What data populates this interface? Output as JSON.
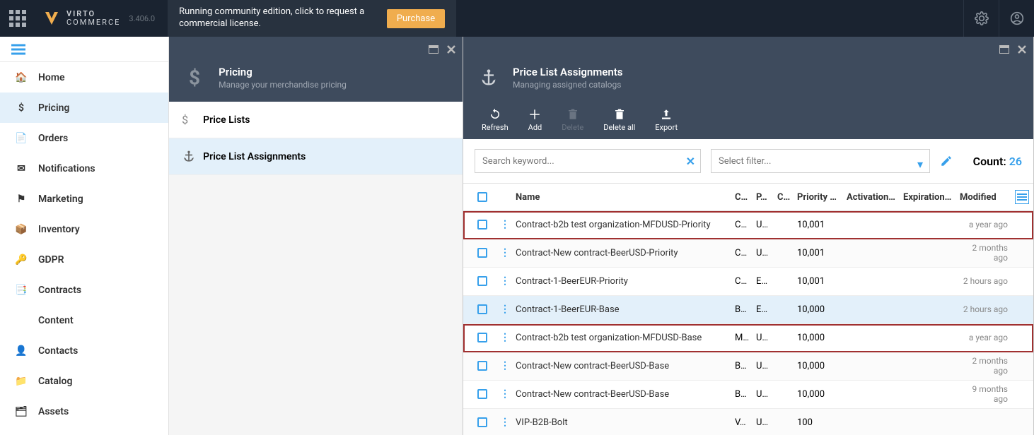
{
  "topbar": {
    "brand_top": "VIRTO",
    "brand_bottom": "COMMERCE",
    "version": "3.406.0",
    "banner": "Running community edition, click to request a commercial license.",
    "purchase": "Purchase"
  },
  "nav": {
    "items": [
      {
        "label": "Home"
      },
      {
        "label": "Pricing"
      },
      {
        "label": "Orders"
      },
      {
        "label": "Notifications"
      },
      {
        "label": "Marketing"
      },
      {
        "label": "Inventory"
      },
      {
        "label": "GDPR"
      },
      {
        "label": "Contracts"
      },
      {
        "label": "Content"
      },
      {
        "label": "Contacts"
      },
      {
        "label": "Catalog"
      },
      {
        "label": "Assets"
      }
    ],
    "active_index": 1
  },
  "blade1": {
    "title": "Pricing",
    "subtitle": "Manage your merchandise pricing",
    "items": [
      {
        "label": "Price Lists"
      },
      {
        "label": "Price List Assignments"
      }
    ],
    "selected_index": 1
  },
  "blade2": {
    "title": "Price List Assignments",
    "subtitle": "Managing assigned catalogs",
    "toolbar": [
      {
        "label": "Refresh",
        "disabled": false
      },
      {
        "label": "Add",
        "disabled": false
      },
      {
        "label": "Delete",
        "disabled": true
      },
      {
        "label": "Delete all",
        "disabled": false
      },
      {
        "label": "Export",
        "disabled": false
      }
    ],
    "search_placeholder": "Search keyword...",
    "filter_placeholder": "Select filter...",
    "count_label": "Count:",
    "count_value": "26",
    "columns": {
      "name": "Name",
      "c3": "C…",
      "c4": "P…",
      "c5": "C…",
      "priority": "Priority …",
      "activation": "Activation…",
      "expiration": "Expiration…",
      "modified": "Modified"
    },
    "rows": [
      {
        "name": "Contract-b2b test organization-MFDUSD-Priority",
        "c3": "C…",
        "c4": "U…",
        "priority": "10,001",
        "modified": "a year ago",
        "highlight": true
      },
      {
        "name": "Contract-New contract-BeerUSD-Priority",
        "c3": "C…",
        "c4": "U…",
        "priority": "10,001",
        "modified": "2 months ago"
      },
      {
        "name": "Contract-1-BeerEUR-Priority",
        "c3": "C…",
        "c4": "E…",
        "priority": "10,001",
        "modified": "2 hours ago"
      },
      {
        "name": "Contract-1-BeerEUR-Base",
        "c3": "B…",
        "c4": "E…",
        "priority": "10,000",
        "modified": "2 hours ago",
        "selected": true
      },
      {
        "name": "Contract-b2b test organization-MFDUSD-Base",
        "c3": "M…",
        "c4": "U…",
        "priority": "10,000",
        "modified": "a year ago",
        "highlight": true
      },
      {
        "name": "Contract-New contract-BeerUSD-Base",
        "c3": "B…",
        "c4": "U…",
        "priority": "10,000",
        "modified": "2 months ago"
      },
      {
        "name": "Contract-New contract-BeerUSD-Base",
        "c3": "B…",
        "c4": "U…",
        "priority": "10,000",
        "modified": "9 months ago"
      },
      {
        "name": "VIP-B2B-Bolt",
        "c3": "V…",
        "c4": "U…",
        "priority": "100",
        "modified": ""
      }
    ]
  }
}
